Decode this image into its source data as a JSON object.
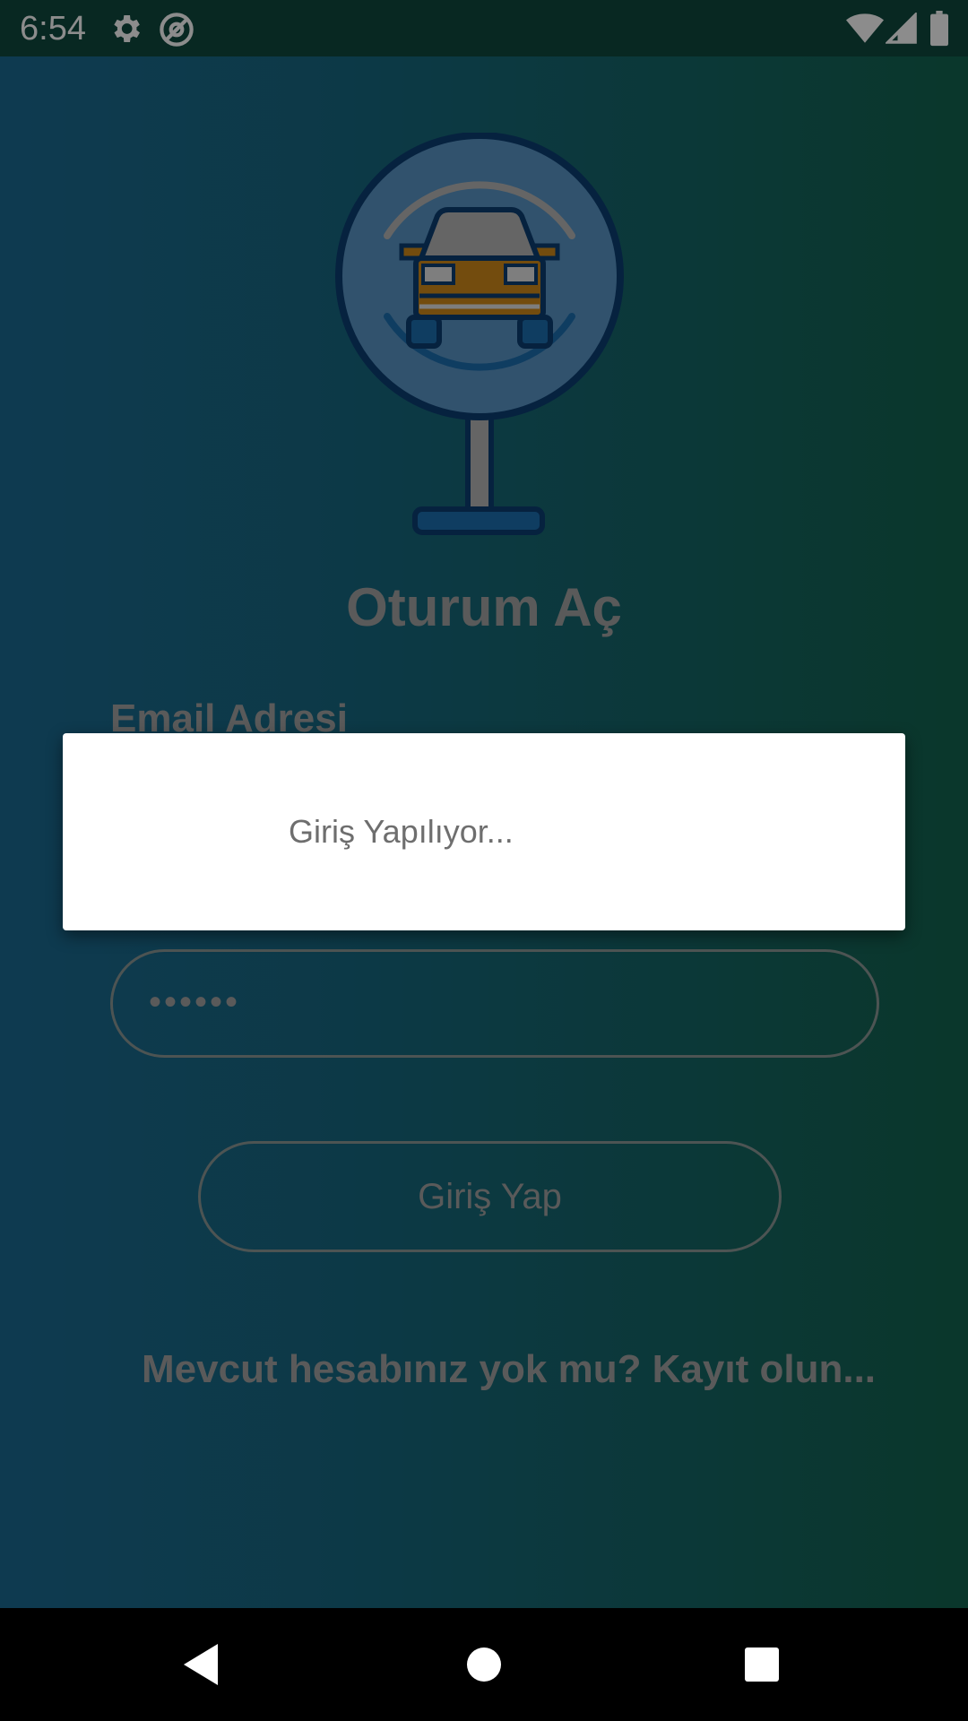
{
  "status_bar": {
    "time": "6:54",
    "icons": [
      "gear-icon",
      "at-sign-icon",
      "wifi-icon",
      "signal-icon",
      "battery-icon"
    ]
  },
  "login": {
    "title": "Oturum Aç",
    "email_label": "Email Adresi",
    "password_value": "••••••",
    "login_button_label": "Giriş Yap",
    "register_link": "Mevcut hesabınız yok mu? Kayıt olun..."
  },
  "dialog": {
    "message": "Giriş Yapılıyor..."
  },
  "nav_bar": {
    "items": [
      "back-icon",
      "home-icon",
      "recents-icon"
    ]
  },
  "colors": {
    "status_bar": "#0f4a3f",
    "gradient_left": "#1b6a93",
    "gradient_right": "#13644f",
    "dim_text": "#a5a5a5",
    "dialog_bg": "#ffffff",
    "dialog_text": "#6e6e6e"
  }
}
